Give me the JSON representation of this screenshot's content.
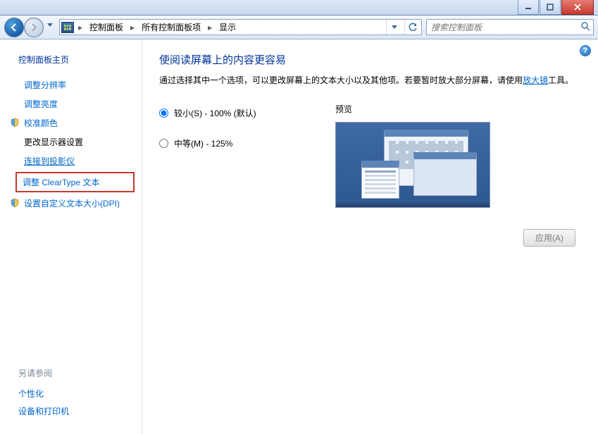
{
  "titlebar": {
    "minimize": "minimize",
    "maximize": "maximize",
    "close": "close"
  },
  "nav": {
    "breadcrumbs": [
      "控制面板",
      "所有控制面板项",
      "显示"
    ],
    "search_placeholder": "搜索控制面板"
  },
  "sidebar": {
    "home": "控制面板主页",
    "items": [
      {
        "label": "调整分辨率",
        "link": true
      },
      {
        "label": "调整亮度",
        "link": true
      },
      {
        "label": "校准颜色",
        "icon": "shield"
      },
      {
        "label": "更改显示器设置",
        "plain": true
      },
      {
        "label": "连接到投影仪",
        "link": true,
        "underline": true
      },
      {
        "label": "调整 ClearType 文本",
        "highlighted": true
      },
      {
        "label": "设置自定义文本大小(DPI)",
        "icon": "shield"
      }
    ],
    "seealso_header": "另请参阅",
    "seealso": [
      "个性化",
      "设备和打印机"
    ]
  },
  "main": {
    "heading": "使阅读屏幕上的内容更容易",
    "description_pre": "通过选择其中一个选项，可以更改屏幕上的文本大小以及其他项。若要暂时放大部分屏幕，请使用",
    "description_link": "放大镜",
    "description_post": "工具。",
    "options": [
      {
        "label": "较小(S) - 100% (默认)",
        "checked": true
      },
      {
        "label": "中等(M) - 125%",
        "checked": false
      }
    ],
    "preview_label": "预览",
    "apply_label": "应用(A)"
  },
  "help_tooltip": "?"
}
